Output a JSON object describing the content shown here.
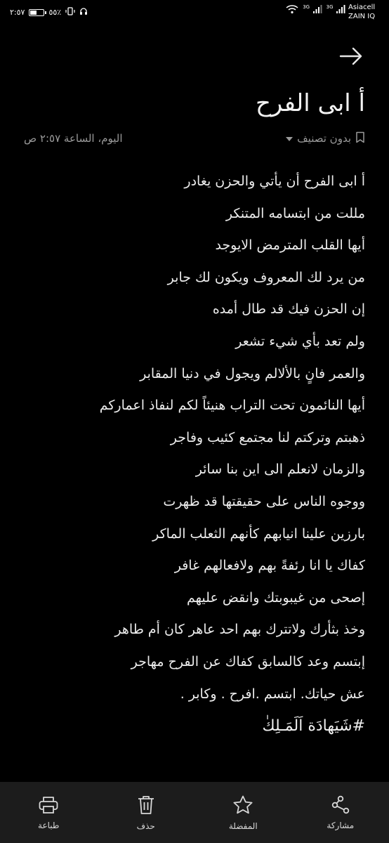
{
  "status_bar": {
    "time": "٢:٥٧",
    "battery_percent_text": "٥٥٪",
    "battery_level": 0.55,
    "network_labels": [
      "3G",
      "3G"
    ],
    "carriers": [
      "Asiacell",
      "ZAIN IQ"
    ]
  },
  "note": {
    "title": "أ ابى الفرح",
    "date": "اليوم، الساعة ٢:٥٧ ص",
    "category": "بدون تصنيف",
    "lines": [
      "أ ابى الفرح أن يأتي والحزن يغادر",
      "مللت من ابتسامه المتنكر",
      "أيها القلب المترمض الايوجد",
      "من يرد لك المعروف ويكون لك جابر",
      "إن الحزن فيك قد طال أمده",
      "ولم تعد بأي شيء تشعر",
      "والعمر فانٍ بالألالم ويجول في دنيا المقابر",
      "أيها النائمون تحت التراب هنيئاً لكم لنفاذ اعماركم",
      "ذهبتم وتركتم لنا مجتمع كئيب وفاجر",
      "والزمان لانعلم الى اين بنا سائر",
      "ووجوه الناس على حقيقتها قد ظهرت",
      "بارزين علينا انيابهم كأنهم الثعلب الماكر",
      "كفاك يا انا رئفةً بهم ولافعالهم غافر",
      "إصحى من غيبوبتك وانقض عليهم",
      "وخذ بثأرك ولاتترك بهم احد عاهر كان أم طاهر",
      "إبتسم وعد كالسابق كفاك عن الفرح مهاجر",
      "عش حياتك. ابتسم .افرح . وكابر ."
    ],
    "hashtag": "#شَيَهادَة اَلَمَـلِكٰ"
  },
  "bottom_bar": {
    "items": [
      {
        "label": "مشاركة",
        "icon": "share-icon"
      },
      {
        "label": "المفضلة",
        "icon": "star-icon"
      },
      {
        "label": "حذف",
        "icon": "trash-icon"
      },
      {
        "label": "طباعة",
        "icon": "print-icon"
      }
    ]
  },
  "colors": {
    "background": "#000000",
    "text": "#ececec",
    "muted": "#9a9a9a",
    "bottom_bar": "#1c1c1c"
  }
}
